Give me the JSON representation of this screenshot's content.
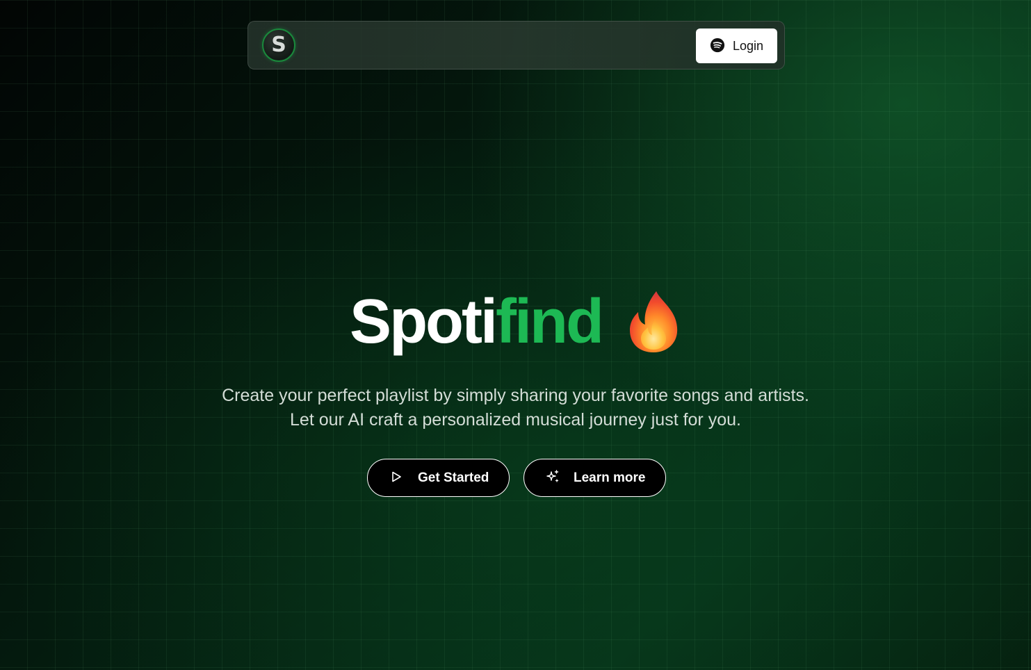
{
  "nav": {
    "logo_letter": "S",
    "login_label": "Login",
    "login_icon": "spotify-icon"
  },
  "hero": {
    "title_part1": "Spoti",
    "title_part2": "find",
    "title_emoji": "flame-icon",
    "subtitle_line1": "Create your perfect playlist by simply sharing your favorite songs and artists.",
    "subtitle_line2": "Let our AI craft a personalized musical journey just for you."
  },
  "actions": {
    "get_started_label": "Get Started",
    "get_started_icon": "play-icon",
    "learn_more_label": "Learn more",
    "learn_more_icon": "sparkles-icon"
  },
  "colors": {
    "brand_green": "#1db954",
    "background": "#041a0e",
    "button_bg": "#000000",
    "login_bg": "#ffffff"
  }
}
